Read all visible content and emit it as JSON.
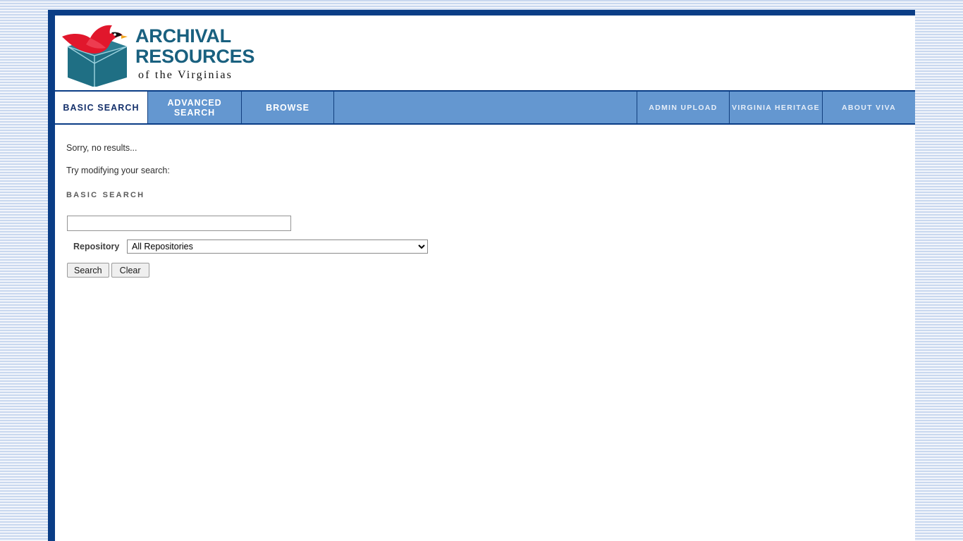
{
  "site": {
    "logo": {
      "line1": "ARCHIVAL",
      "line2": "RESOURCES",
      "tagline": "of the Virginias",
      "bird_color": "#e1172c",
      "box_color": "#1f6f84",
      "wordmark_color": "#19607f"
    }
  },
  "nav": {
    "primary": [
      {
        "label": "BASIC SEARCH",
        "active": true
      },
      {
        "label": "ADVANCED SEARCH",
        "active": false
      },
      {
        "label": "BROWSE",
        "active": false
      }
    ],
    "secondary": [
      {
        "label": "ADMIN UPLOAD"
      },
      {
        "label": "VIRGINIA HERITAGE"
      },
      {
        "label": "ABOUT VIVA"
      }
    ]
  },
  "main": {
    "no_results_message": "Sorry, no results...",
    "modify_prompt": "Try modifying your search:",
    "heading": "Basic Search",
    "form": {
      "keyword_value": "",
      "keyword_placeholder": "",
      "repository_label": "Repository",
      "repository_selected": "All Repositories",
      "repository_options": [
        "All Repositories"
      ],
      "search_button": "Search",
      "clear_button": "Clear"
    }
  },
  "theme": {
    "frame_navy": "#0a3d86",
    "tab_blue": "#6497d0",
    "tab_active_bg": "#ffffff",
    "tab_active_text": "#14306b",
    "page_stripe_blue": "#c9d8ef"
  }
}
